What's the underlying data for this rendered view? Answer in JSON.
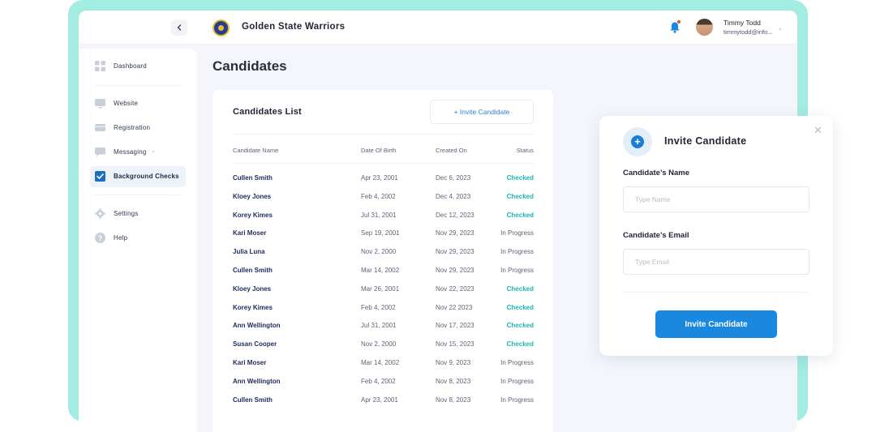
{
  "header": {
    "org_name": "Golden State Warriors",
    "user_name": "Timmy Todd",
    "user_email": "timmytodd@info..."
  },
  "sidebar": {
    "items": [
      {
        "label": "Dashboard",
        "icon": "dashboard-grid-icon"
      },
      {
        "label": "Website",
        "icon": "monitor-icon"
      },
      {
        "label": "Registration",
        "icon": "card-icon"
      },
      {
        "label": "Messaging",
        "icon": "chat-icon"
      },
      {
        "label": "Background Checks",
        "icon": "checkbox-icon",
        "active": true
      },
      {
        "label": "Settings",
        "icon": "gear-icon"
      },
      {
        "label": "Help",
        "icon": "help-icon"
      }
    ]
  },
  "page": {
    "title": "Candidates"
  },
  "list": {
    "title": "Candidates List",
    "invite_button": "+ Invite Candidate",
    "columns": [
      "Candidate Name",
      "Date Of Birth",
      "Created On",
      "Status"
    ],
    "rows": [
      {
        "name": "Cullen Smith",
        "dob": "Apr 23, 2001",
        "created": "Dec 6, 2023",
        "status": "Checked"
      },
      {
        "name": "Kloey Jones",
        "dob": "Feb 4, 2002",
        "created": "Dec 4, 2023",
        "status": "Checked"
      },
      {
        "name": "Korey Kimes",
        "dob": "Jul 31, 2001",
        "created": "Dec 12, 2023",
        "status": "Checked"
      },
      {
        "name": "Kari Moser",
        "dob": "Sep 19, 2001",
        "created": "Nov 29, 2023",
        "status": "In Progress"
      },
      {
        "name": "Julia Luna",
        "dob": "Nov 2, 2000",
        "created": "Nov 29, 2023",
        "status": "In Progress"
      },
      {
        "name": "Cullen Smith",
        "dob": "Mar 14, 2002",
        "created": "Nov 29, 2023",
        "status": "In Progress"
      },
      {
        "name": "Kloey Jones",
        "dob": "Mar 26, 2001",
        "created": "Nov 22, 2023",
        "status": "Checked"
      },
      {
        "name": "Korey Kimes",
        "dob": "Feb 4, 2002",
        "created": "Nov 22 2023",
        "status": "Checked"
      },
      {
        "name": "Ann Wellington",
        "dob": "Jul 31, 2001",
        "created": "Nov 17, 2023",
        "status": "Checked"
      },
      {
        "name": "Susan Cooper",
        "dob": "Nov 2, 2000",
        "created": "Nov 15, 2023",
        "status": "Checked"
      },
      {
        "name": "Kari Moser",
        "dob": "Mar 14, 2002",
        "created": "Nov 9, 2023",
        "status": "In Progress"
      },
      {
        "name": "Ann Wellington",
        "dob": "Feb 4, 2002",
        "created": "Nov 8, 2023",
        "status": "In Progress"
      },
      {
        "name": "Cullen Smith",
        "dob": "Apr 23, 2001",
        "created": "Nov 8, 2023",
        "status": "In Progress"
      }
    ]
  },
  "invite_panel": {
    "title": "Invite Candidate",
    "name_label": "Candidate’s Name",
    "name_placeholder": "Type Name",
    "email_label": "Candidate’s Email",
    "email_placeholder": "Type Email",
    "submit": "Invite Candidate"
  },
  "colors": {
    "accent": "#1a88df",
    "frame": "#a3ece2",
    "checked": "#21b5b0",
    "name_text": "#1e2a5a"
  }
}
